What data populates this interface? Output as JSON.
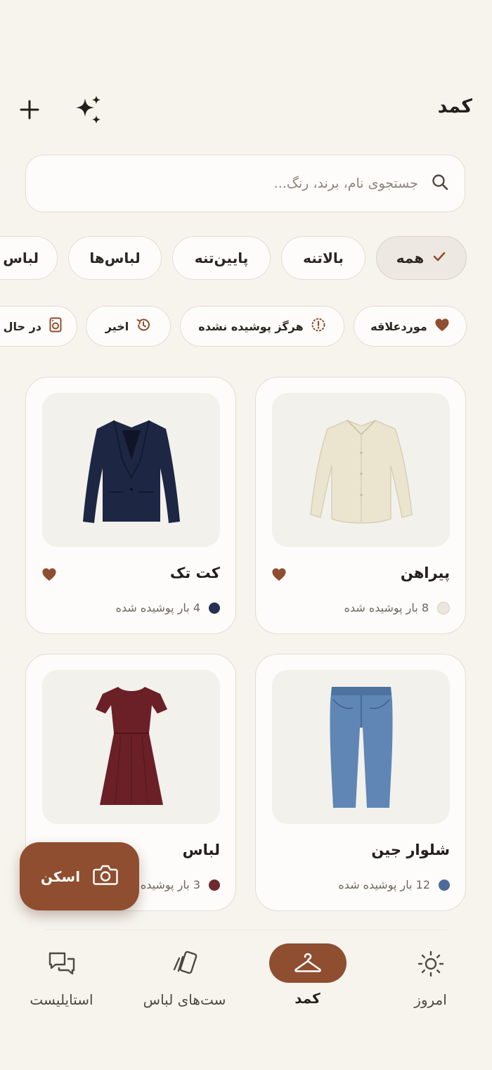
{
  "header": {
    "title": "کمد"
  },
  "search": {
    "placeholder": "جستجوی نام، برند، رنگ..."
  },
  "categories": [
    "همه",
    "بالاتنه",
    "پایین‌تنه",
    "لباس‌ها",
    "لباس"
  ],
  "filters": [
    "موردعلاقه",
    "هرگز پوشیده نشده",
    "اخیر",
    "در حال"
  ],
  "items": [
    {
      "name": "پیراهن",
      "worn": "8 بار پوشیده شده",
      "color": "#ece7dc"
    },
    {
      "name": "کت تک",
      "worn": "4 بار پوشیده شده",
      "color": "#25314f"
    },
    {
      "name": "شلوار جین",
      "worn": "12 بار پوشیده شده",
      "color": "#4e6a9a"
    },
    {
      "name": "لباس",
      "worn": "3 بار پوشیده شده",
      "color": "#6e2a2e"
    }
  ],
  "fab": {
    "label": "اسکن"
  },
  "nav": [
    "امروز",
    "کمد",
    "ست‌های لباس",
    "استایلیست"
  ],
  "colors": {
    "accent": "#8f4e2f",
    "background": "#f7f4ee"
  }
}
